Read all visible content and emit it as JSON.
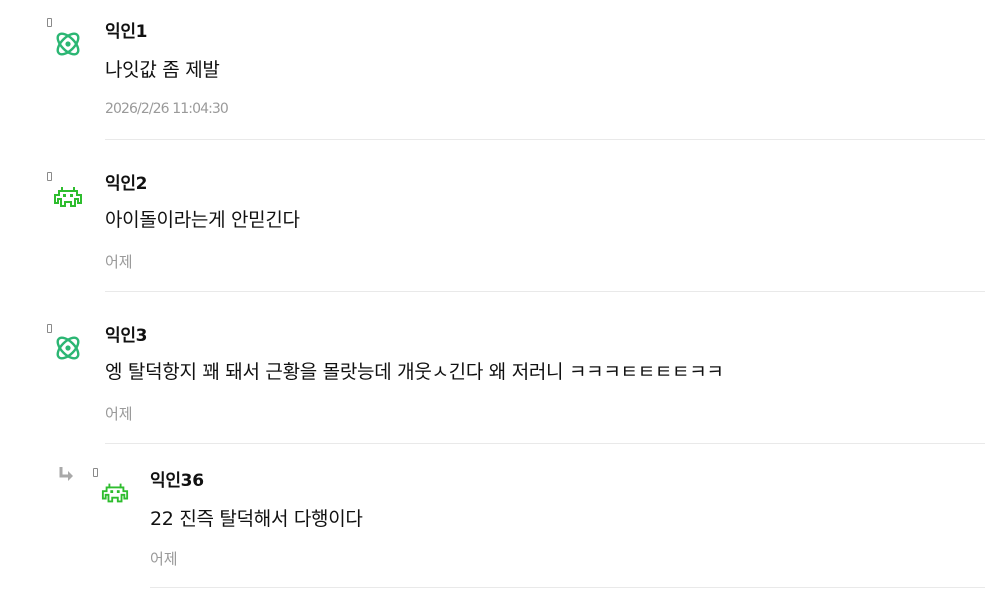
{
  "comments": [
    {
      "author": "익인1",
      "avatar_icon": "atom-icon",
      "avatar_color": "#2bb673",
      "text": "나잇값 좀 제발",
      "time": "2026/2/26 11:04:30"
    },
    {
      "author": "익인2",
      "avatar_icon": "space-invader-icon",
      "avatar_color": "#2ebd2e",
      "text": "아이돌이라는게 안믿긴다",
      "time": "어제"
    },
    {
      "author": "익인3",
      "avatar_icon": "atom-icon",
      "avatar_color": "#2bb673",
      "text": "엥 탈덕항지 꽤 돼서 근황을 몰랏능데 개웃ㅅ긴다 왜 저러니 ㅋㅋㅋㅌㅌㅌㅌㅋㅋ",
      "time": "어제"
    }
  ],
  "replies": [
    {
      "author": "익인36",
      "avatar_icon": "space-invader-icon",
      "avatar_color": "#2ebd2e",
      "reply_icon": "reply-arrow-icon",
      "text": "22 진즉 탈덕해서 다행이다",
      "time": "어제"
    }
  ]
}
